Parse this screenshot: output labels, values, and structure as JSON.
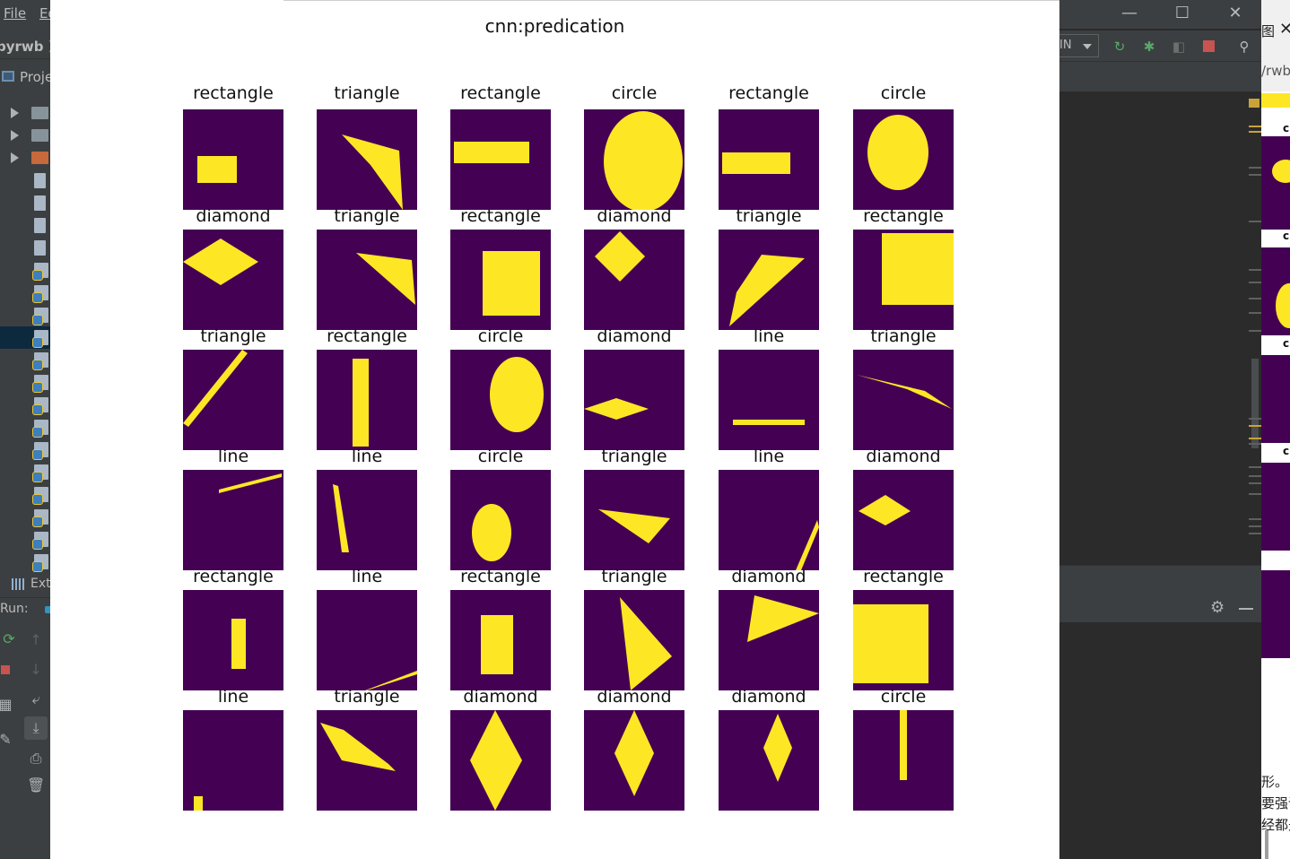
{
  "ide_left": {
    "menu": {
      "file": "File",
      "edit": "Ed"
    },
    "project_name": "pyrwb",
    "project_tab": "Proje",
    "extra_tab": "Ext",
    "run_label": "Run:"
  },
  "ide_right": {
    "run_config": "IN"
  },
  "far_right": {
    "top_char": "图",
    "close": "✕",
    "url_fragment": "/rwb",
    "labels": [
      "c",
      "c",
      "c",
      "c"
    ],
    "text_lines": [
      "形。",
      "要强训",
      "经都是"
    ]
  },
  "figure": {
    "title": "cnn:predication",
    "colors": {
      "background": "#440154",
      "shape": "#fde725"
    },
    "panels": [
      "rectangle",
      "triangle",
      "rectangle",
      "circle",
      "rectangle",
      "circle",
      "diamond",
      "triangle",
      "rectangle",
      "diamond",
      "triangle",
      "rectangle",
      "triangle",
      "rectangle",
      "circle",
      "diamond",
      "line",
      "triangle",
      "line",
      "line",
      "circle",
      "triangle",
      "line",
      "diamond",
      "rectangle",
      "line",
      "rectangle",
      "triangle",
      "diamond",
      "rectangle",
      "line",
      "triangle",
      "diamond",
      "diamond",
      "diamond",
      "circle"
    ]
  }
}
